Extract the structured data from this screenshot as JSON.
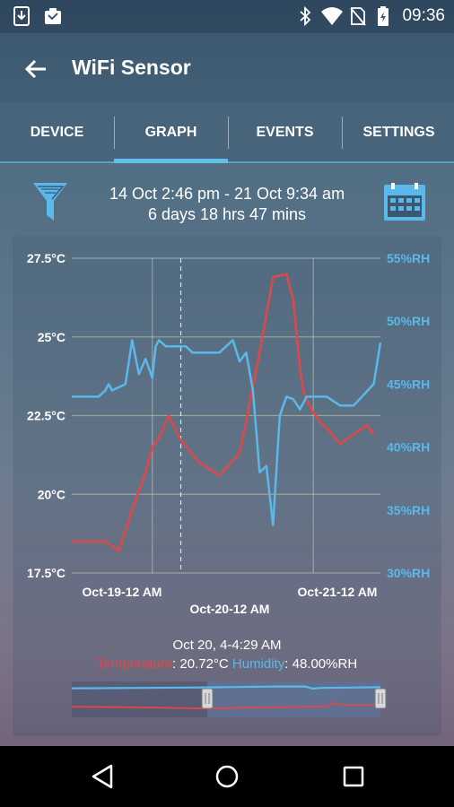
{
  "status_bar": {
    "time": "09:36",
    "icons": [
      "download-icon",
      "clipboard-icon",
      "bluetooth-icon",
      "wifi-icon",
      "no-sim-icon",
      "battery-icon"
    ]
  },
  "app_bar": {
    "title": "WiFi Sensor"
  },
  "tabs": [
    {
      "label": "DEVICE",
      "active": false
    },
    {
      "label": "GRAPH",
      "active": true
    },
    {
      "label": "EVENTS",
      "active": false
    },
    {
      "label": "SETTINGS",
      "active": false
    }
  ],
  "date_range": {
    "range_text": "14 Oct 2:46 pm - 21 Oct 9:34 am",
    "duration_text": "6 days 18 hrs 47 mins"
  },
  "colors": {
    "temperature": "#e04848",
    "humidity": "#5ab8ea",
    "accent": "#5fc0ec"
  },
  "readout": {
    "datetime": "Oct 20, 4-4:29 AM",
    "temp_label": "Temperature",
    "temp_value": ": 20.72°C ",
    "hum_label": "Humidity",
    "hum_value": ": 48.00%RH"
  },
  "chart_data": {
    "type": "line",
    "grid": true,
    "yaxis_left": {
      "unit": "°C",
      "range": [
        17.5,
        27.5
      ],
      "ticks": [
        "27.5°C",
        "25°C",
        "22.5°C",
        "20°C",
        "17.5°C"
      ]
    },
    "yaxis_right": {
      "unit": "%RH",
      "range": [
        30,
        55
      ],
      "ticks": [
        "55%RH",
        "50%RH",
        "45%RH",
        "40%RH",
        "35%RH",
        "30%RH"
      ]
    },
    "x_ticks": [
      "Oct-19-12 AM",
      "Oct-20-12 AM",
      "Oct-21-12 AM"
    ],
    "x_range_hours": [
      -12,
      34
    ],
    "cursor_hours": 4.25,
    "series": [
      {
        "name": "Temperature",
        "axis": "left",
        "x": [
          -12,
          -10,
          -7,
          -5,
          -3,
          -1,
          0,
          1,
          1.5,
          2,
          2.5,
          4,
          7,
          10,
          13,
          16,
          18,
          20,
          21,
          22,
          22.5,
          23,
          23.5,
          24,
          25,
          26,
          28,
          30,
          32,
          33
        ],
        "y": [
          18.5,
          18.5,
          18.5,
          18.2,
          19.5,
          20.7,
          21.5,
          21.8,
          22.0,
          22.3,
          22.5,
          21.8,
          21.0,
          20.6,
          21.3,
          24.5,
          26.9,
          27.0,
          26.2,
          24.0,
          23.3,
          23.0,
          22.8,
          22.6,
          22.3,
          22.1,
          21.6,
          21.9,
          22.2,
          21.9
        ]
      },
      {
        "name": "Humidity",
        "axis": "right",
        "x": [
          -12,
          -9,
          -8,
          -7,
          -6.5,
          -6,
          -4,
          -3,
          -2,
          -1,
          0,
          0.5,
          1,
          2,
          3,
          4,
          5,
          6,
          8,
          10,
          12,
          13,
          14,
          15,
          16,
          17,
          18,
          19,
          20,
          21,
          22,
          23,
          24,
          26,
          28,
          30,
          33,
          34
        ],
        "y": [
          44.0,
          44.0,
          44.0,
          44.5,
          45.0,
          44.5,
          45.0,
          48.5,
          45.8,
          47.0,
          45.5,
          48.0,
          48.5,
          48.0,
          48.0,
          48.0,
          48.0,
          47.5,
          47.5,
          47.5,
          48.5,
          46.8,
          47.5,
          44.5,
          38.0,
          38.5,
          33.8,
          42.5,
          44.0,
          43.8,
          43.0,
          44.0,
          44.0,
          44.0,
          43.3,
          43.3,
          45.0,
          48.3
        ]
      }
    ]
  },
  "navigation": {
    "buttons": [
      "back-nav-icon",
      "home-nav-icon",
      "recents-nav-icon"
    ]
  }
}
